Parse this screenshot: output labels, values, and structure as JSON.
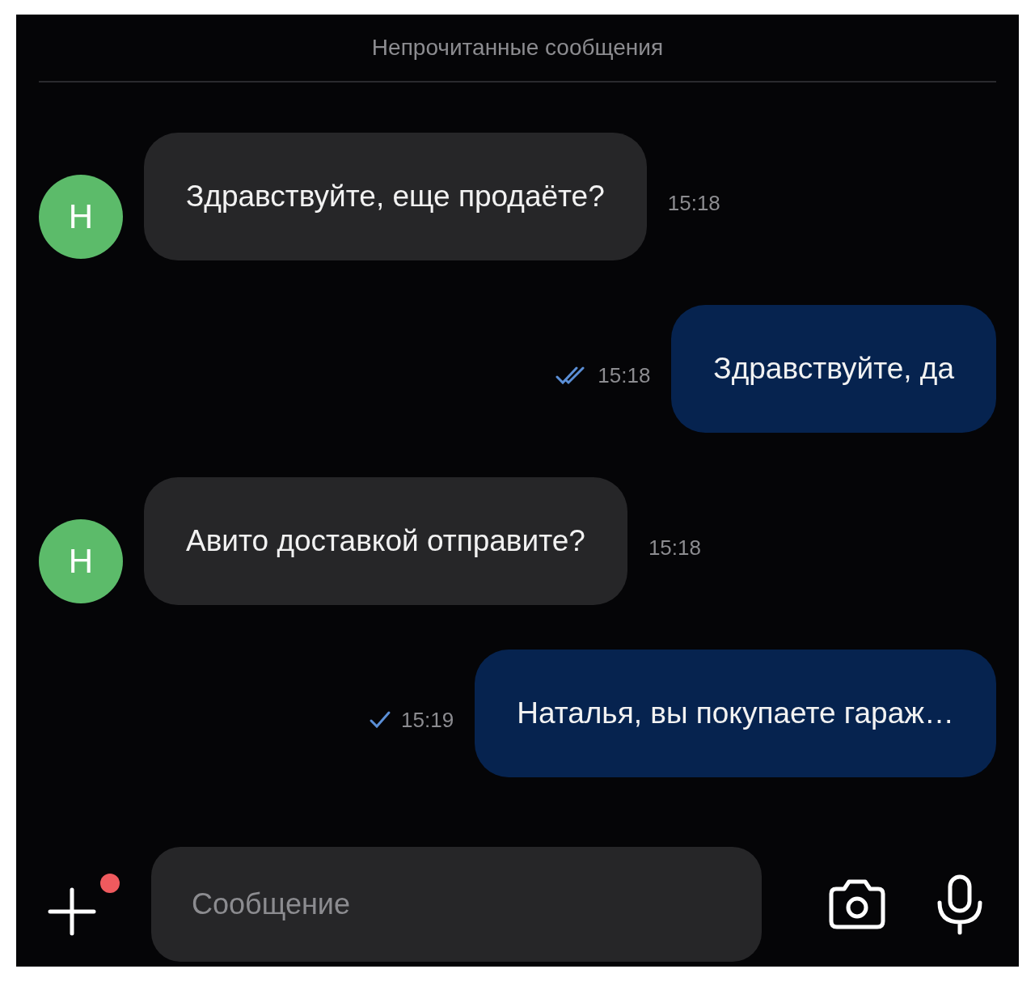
{
  "header": {
    "title": "Непрочитанные сообщения"
  },
  "messages": [
    {
      "kind": "incoming",
      "avatar": "Н",
      "text": "Здравствуйте, еще продаёте?",
      "time": "15:18"
    },
    {
      "kind": "outgoing",
      "text": "Здравствуйте, да",
      "time": "15:18",
      "read": true
    },
    {
      "kind": "incoming",
      "avatar": "Н",
      "text": "Авито доставкой отправите?",
      "time": "15:18"
    },
    {
      "kind": "outgoing",
      "text": "Наталья, вы покупаете гараж…",
      "time": "15:19",
      "read": false
    }
  ],
  "composer": {
    "placeholder": "Сообщение",
    "attach_badge": true
  }
}
